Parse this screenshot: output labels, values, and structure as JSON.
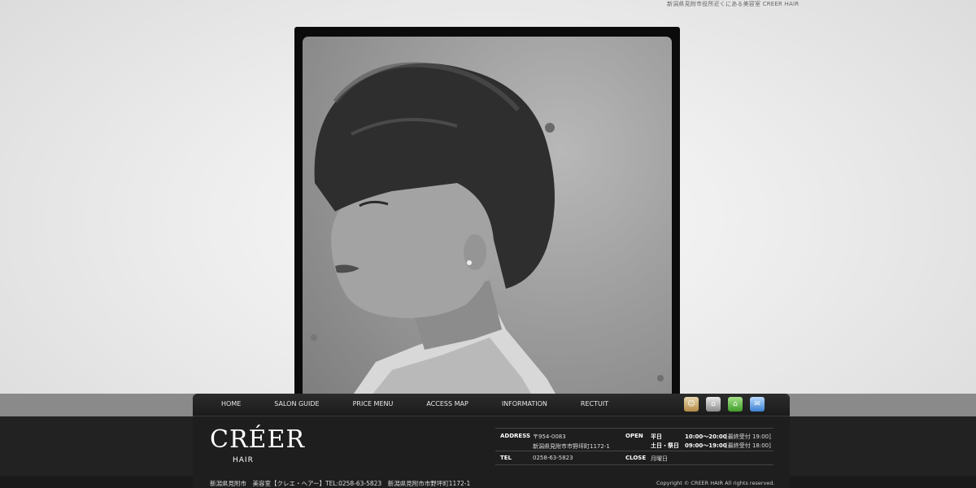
{
  "header": {
    "tagline": "新潟県見附市役所近くにある美容室 CREER HAIR"
  },
  "nav": {
    "items": [
      "HOME",
      "SALON GUIDE",
      "PRICE MENU",
      "ACCESS MAP",
      "INFORMATION",
      "RECTUIT"
    ],
    "icons": [
      "ameblo-icon",
      "home-icon",
      "green-home-icon",
      "mail-icon"
    ]
  },
  "brand": {
    "logo": "CRÉER",
    "sub": "HAIR"
  },
  "info": {
    "address_label": "ADDRESS",
    "postal": "〒954-0083",
    "address": "新潟県見附市市野坪町1172-1",
    "open_label": "OPEN",
    "weekday_label": "平日",
    "weekday_hours": "10:00〜20:00",
    "weekday_last": "[最終受付 19:00]",
    "weekend_label": "土日・祭日",
    "weekend_hours": "09:00〜19:00",
    "weekend_last": "[最終受付 18:00]",
    "tel_label": "TEL",
    "tel": "0258-63-5823",
    "close_label": "CLOSE",
    "close": "月曜日"
  },
  "footer": {
    "left": "新潟県見附市　美容室【クレエ・ヘアー】TEL:0258-63-5823　新潟県見附市市野坪町1172-1",
    "right": "Copyright © CREER HAIR All rights reserved."
  },
  "colors": {
    "panel": "#1e1e1e",
    "band": "#8a8a8a"
  }
}
